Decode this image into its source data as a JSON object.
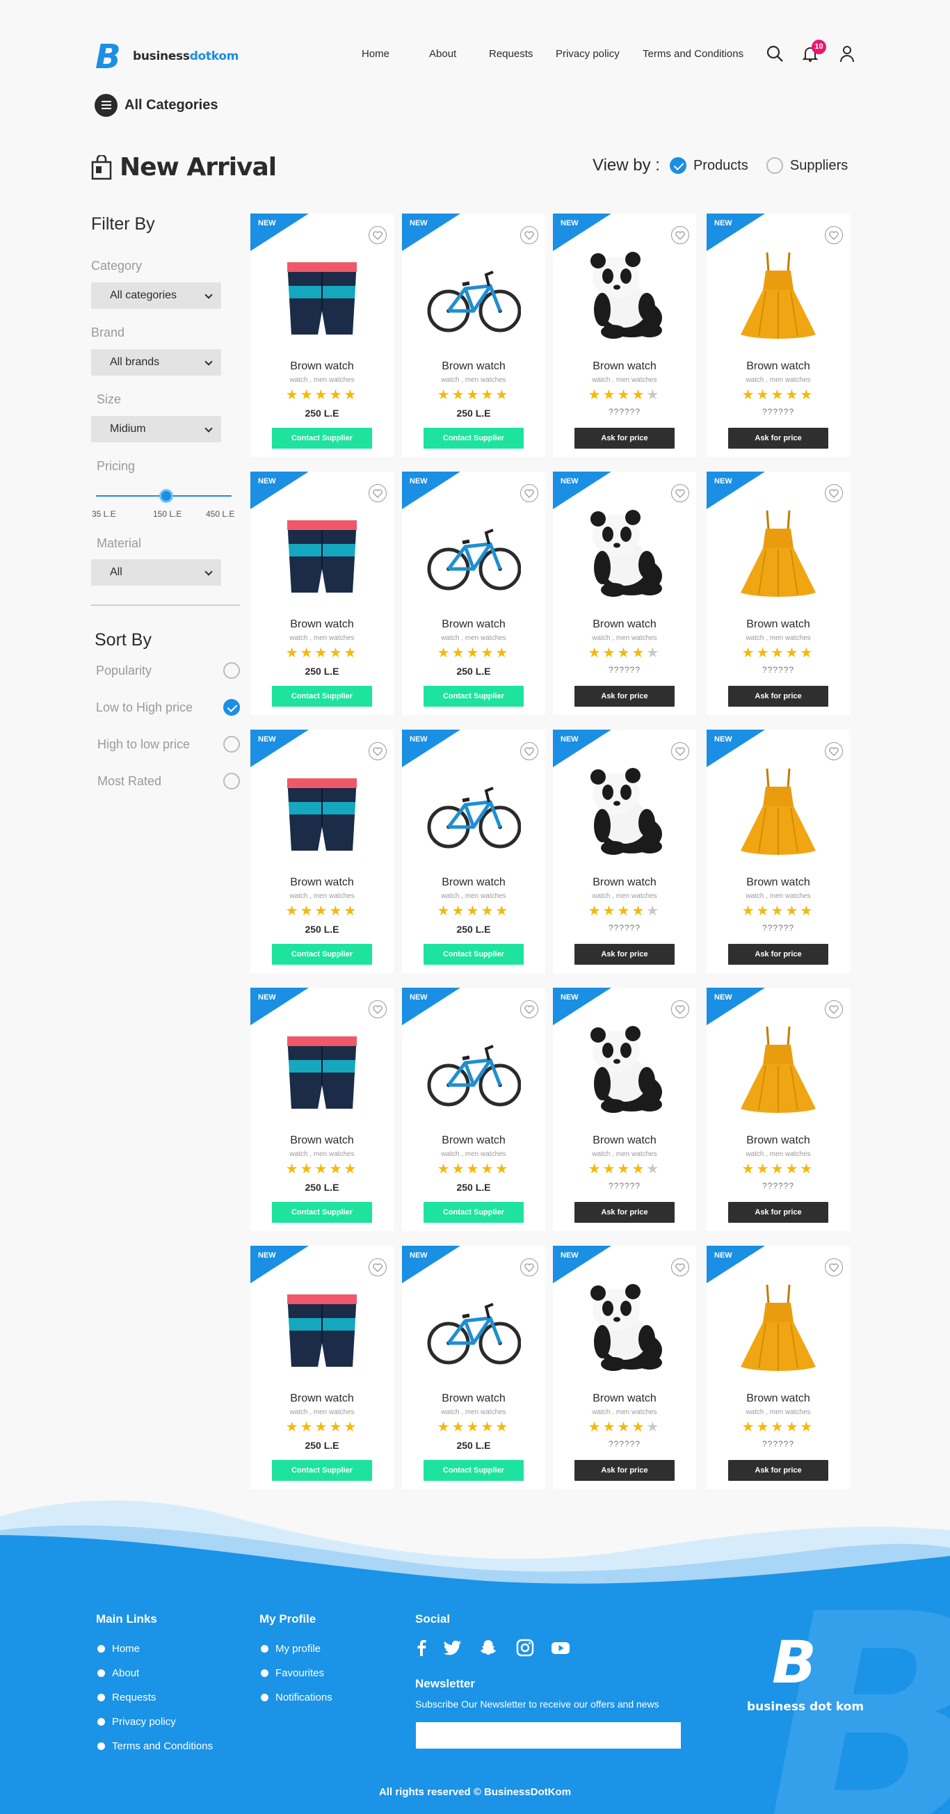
{
  "header": {
    "logo_text_1": "business",
    "logo_text_2": "dot",
    "logo_text_3": "kom",
    "nav": [
      "Home",
      "About",
      "Requests",
      "Privacy policy",
      "Terms and Conditions"
    ],
    "notification_count": "10",
    "all_categories": "All Categories"
  },
  "page": {
    "title": "New Arrival",
    "view_by_label": "View by :",
    "view_options": [
      {
        "label": "Products",
        "selected": true
      },
      {
        "label": "Suppliers",
        "selected": false
      }
    ]
  },
  "filters": {
    "heading": "Filter By",
    "category_label": "Category",
    "category_value": "All categories",
    "brand_label": "Brand",
    "brand_value": "All brands",
    "size_label": "Size",
    "size_value": "Midium",
    "pricing_label": "Pricing",
    "price_min": "35 L.E",
    "price_current": "150 L.E",
    "price_max": "450 L.E",
    "material_label": "Material",
    "material_value": "All"
  },
  "sort": {
    "heading": "Sort By",
    "options": [
      {
        "label": "Popularity",
        "selected": false
      },
      {
        "label": "Low to High price",
        "selected": true
      },
      {
        "label": "High to low price",
        "selected": false
      },
      {
        "label": "Most Rated",
        "selected": false
      }
    ]
  },
  "product_columns": [
    {
      "badge": "NEW",
      "image": "swim-shorts",
      "name": "Brown watch",
      "sub": "watch , men watches",
      "rating": 5,
      "price": "250 L.E",
      "button": "Contact Supplier",
      "button_style": "green"
    },
    {
      "badge": "NEW",
      "image": "bicycle",
      "name": "Brown watch",
      "sub": "watch , men watches",
      "rating": 5,
      "price": "250 L.E",
      "button": "Contact Supplier",
      "button_style": "green"
    },
    {
      "badge": "NEW",
      "image": "panda-plush",
      "name": "Brown watch",
      "sub": "watch , men watches",
      "rating": 4,
      "price": "??????",
      "button": "Ask for price",
      "button_style": "dark"
    },
    {
      "badge": "NEW",
      "image": "dress",
      "name": "Brown watch",
      "sub": "watch , men watches",
      "rating": 5,
      "price": "??????",
      "button": "Ask for price",
      "button_style": "dark"
    }
  ],
  "product_rows": 5,
  "footer": {
    "main_links_heading": "Main Links",
    "main_links": [
      "Home",
      "About",
      "Requests",
      "Privacy policy",
      "Terms and Conditions"
    ],
    "profile_heading": "My Profile",
    "profile_links": [
      "My profile",
      "Favourites",
      "Notifications"
    ],
    "social_heading": "Social",
    "social_icons": [
      "facebook-icon",
      "twitter-icon",
      "snapchat-icon",
      "instagram-icon",
      "youtube-icon"
    ],
    "newsletter_heading": "Newsletter",
    "newsletter_sub": "Subscribe Our Newsletter to receive our offers and news",
    "newsletter_placeholder": "",
    "logo_text": "business dot kom",
    "copyright": "All rights reserved © BusinessDotKom"
  },
  "colors": {
    "accent": "#1a8fe3",
    "green": "#1ee39e",
    "dark": "#2f2f2f",
    "star": "#f5b90a",
    "badge": "#e8196e"
  }
}
